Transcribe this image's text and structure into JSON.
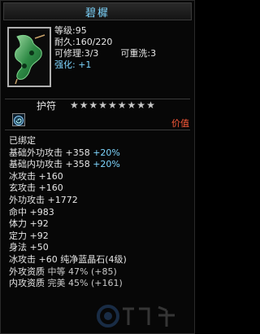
{
  "header": {
    "title": "碧樨"
  },
  "item": {
    "level_label": "等级:95",
    "durability_label": "耐久:160/220",
    "repair_label": "可修理:3/3",
    "rewash_label": "可重洗:3",
    "enhance_label": "强化:",
    "enhance_value": "+1"
  },
  "amulet": {
    "label": "护符",
    "stars": "★★★★★★★★★"
  },
  "price": "价值",
  "details": [
    {
      "id": "bind",
      "text": "已绑定"
    },
    {
      "id": "base_outer",
      "name": "基础外功攻击",
      "value": "+358",
      "bonus": "+20%"
    },
    {
      "id": "base_inner",
      "name": "基础内功攻击",
      "value": "+358",
      "bonus": "+20%"
    },
    {
      "id": "ice",
      "name": "冰攻击",
      "value": "+160"
    },
    {
      "id": "xuan",
      "name": "玄攻击",
      "value": "+160"
    },
    {
      "id": "outer",
      "name": "外功攻击",
      "value": "+1772"
    },
    {
      "id": "hit",
      "name": "命中",
      "value": "+983"
    },
    {
      "id": "phys",
      "name": "体力",
      "value": "+92"
    },
    {
      "id": "fix",
      "name": "定力",
      "value": "+92"
    },
    {
      "id": "body",
      "name": "身法",
      "value": "+50"
    },
    {
      "id": "gem",
      "text": "冰攻击 +60 纯净蓝晶石(4级)"
    },
    {
      "id": "q_outer",
      "name": "外攻资质",
      "value": "中等 47%",
      "extra": "(+85)"
    },
    {
      "id": "q_inner",
      "name": "内攻资质",
      "value": "完美 45%",
      "extra": "(+161)"
    }
  ]
}
